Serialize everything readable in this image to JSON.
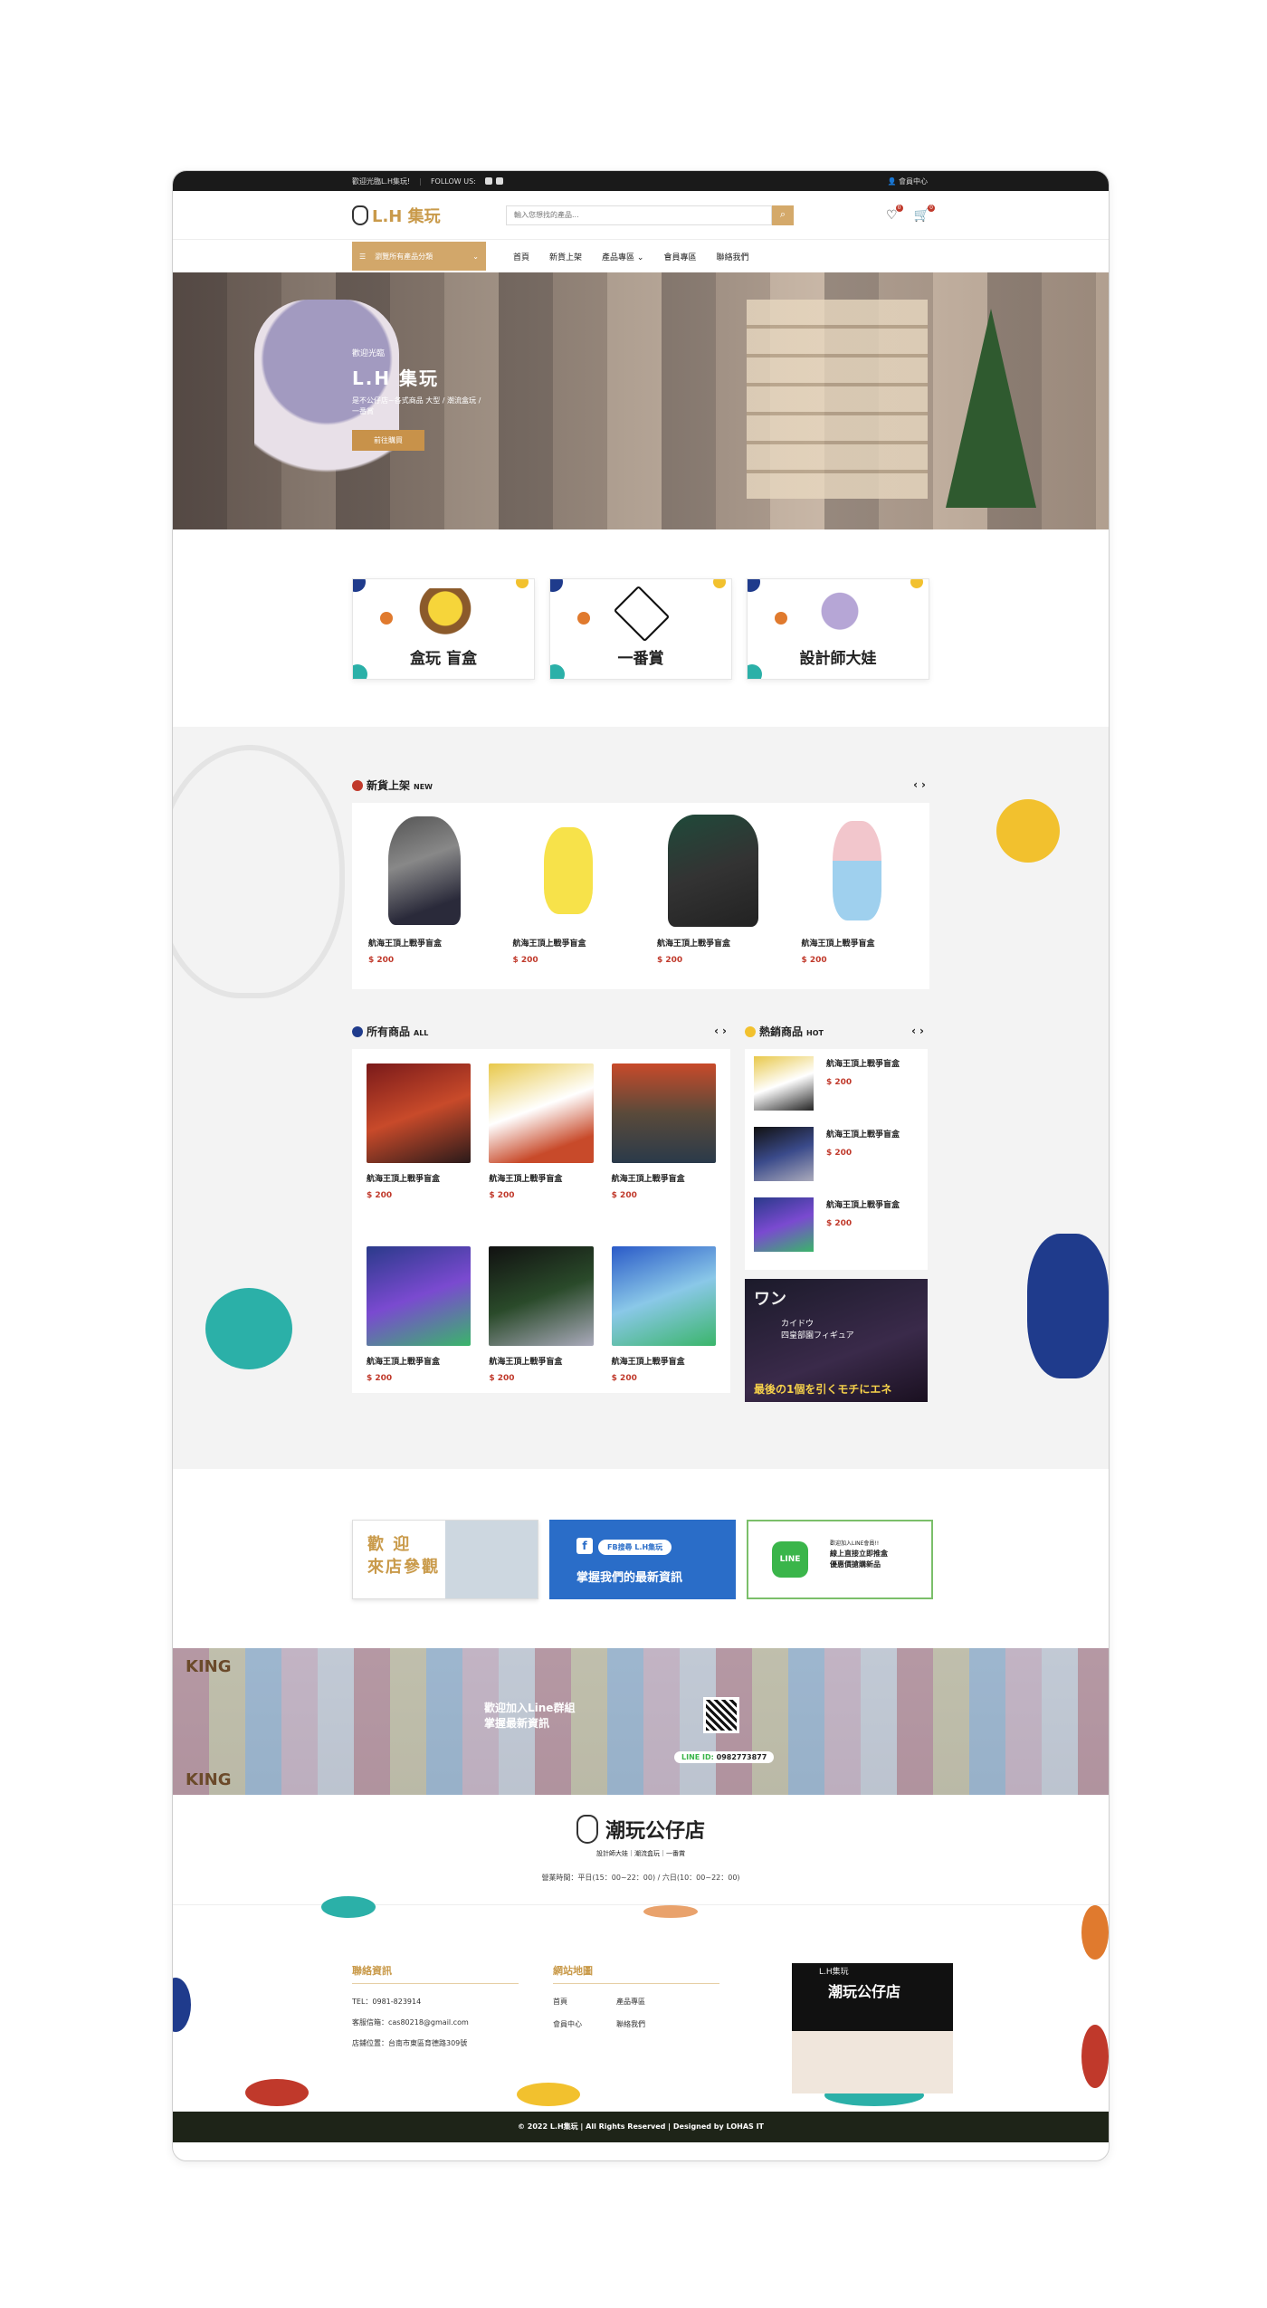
{
  "topbar": {
    "welcome": "歡迎光臨L.H集玩!",
    "follow": "FOLLOW US:",
    "member": "會員中心"
  },
  "header": {
    "logo": "L.H 集玩",
    "search_placeholder": "輸入您想找的產品...",
    "wish_count": "0",
    "cart_count": "0"
  },
  "nav": {
    "category_button": "瀏覽所有產品分類",
    "links": [
      "首頁",
      "新貨上架",
      "產品專區",
      "會員專區",
      "聯絡我們"
    ]
  },
  "hero": {
    "small": "歡迎光臨",
    "title": "L.H 集玩",
    "desc": "是不公仔店~各式商品 大型 / 潮流盒玩 / 一番賞",
    "button": "前往購買"
  },
  "categories": [
    {
      "title": "盒玩 盲盒"
    },
    {
      "title": "一番賞"
    },
    {
      "title": "設計師大娃"
    }
  ],
  "new_arrivals": {
    "title": "新貨上架",
    "sub": "NEW",
    "items": [
      {
        "name": "航海王頂上戰爭盲盒",
        "price": "$ 200"
      },
      {
        "name": "航海王頂上戰爭盲盒",
        "price": "$ 200"
      },
      {
        "name": "航海王頂上戰爭盲盒",
        "price": "$ 200"
      },
      {
        "name": "航海王頂上戰爭盲盒",
        "price": "$ 200"
      }
    ]
  },
  "all_products": {
    "title": "所有商品",
    "sub": "ALL",
    "items": [
      {
        "name": "航海王頂上戰爭盲盒",
        "price": "$ 200"
      },
      {
        "name": "航海王頂上戰爭盲盒",
        "price": "$ 200"
      },
      {
        "name": "航海王頂上戰爭盲盒",
        "price": "$ 200"
      },
      {
        "name": "航海王頂上戰爭盲盒",
        "price": "$ 200"
      },
      {
        "name": "航海王頂上戰爭盲盒",
        "price": "$ 200"
      },
      {
        "name": "航海王頂上戰爭盲盒",
        "price": "$ 200"
      }
    ]
  },
  "hot": {
    "title": "熱銷商品",
    "sub": "HOT",
    "items": [
      {
        "name": "航海王頂上戰爭盲盒",
        "price": "$ 200"
      },
      {
        "name": "航海王頂上戰爭盲盒",
        "price": "$ 200"
      },
      {
        "name": "航海王頂上戰爭盲盒",
        "price": "$ 200"
      }
    ],
    "ad": {
      "t1": "ワン",
      "t2": "カイドウ\n四皇部園フィギュア",
      "t3": "最後の1個を引くモチにエネ"
    }
  },
  "banners": {
    "welcome": "歡 迎\n來店參觀",
    "fb_pill": "FB搜尋 L.H集玩",
    "fb_text": "掌握我們的最新資訊",
    "line_icon": "LINE",
    "line_small": "歡迎加入LINE會員!!",
    "line_text1": "線上直接立即推盒",
    "line_text2": "優惠價搶購新品"
  },
  "store": {
    "msg1": "歡迎加入Line群組",
    "msg2": "掌握最新資訊",
    "line_id_label": "LINE ID:",
    "line_id": "0982773877",
    "king": "KING"
  },
  "brand": {
    "name": "潮玩公仔店",
    "tag": "設計師大娃｜潮流盒玩｜一番賞",
    "hours": "營業時間：平日(15：00~22：00) / 六日(10：00~22：00)"
  },
  "footer": {
    "contact_title": "聯絡資訊",
    "tel": "TEL：0981-823914",
    "email": "客服信箱：cas80218@gmail.com",
    "address": "店鋪位置：台南市東區育德路309號",
    "sitemap_title": "網站地圖",
    "sitemap": [
      "首頁",
      "產品專區",
      "會員中心",
      "聯絡我們"
    ],
    "fb_card_top": "L.H集玩",
    "fb_card_title": "潮玩公仔店",
    "copyright": "© 2022 L.H集玩 | All Rights Reserved | Designed by LOHAS IT"
  },
  "colors": {
    "gold": "#c99a4a",
    "price": "#c0392b",
    "dark": "#1a1a1a",
    "fb": "#2a6dc8",
    "line": "#3ab54a"
  }
}
